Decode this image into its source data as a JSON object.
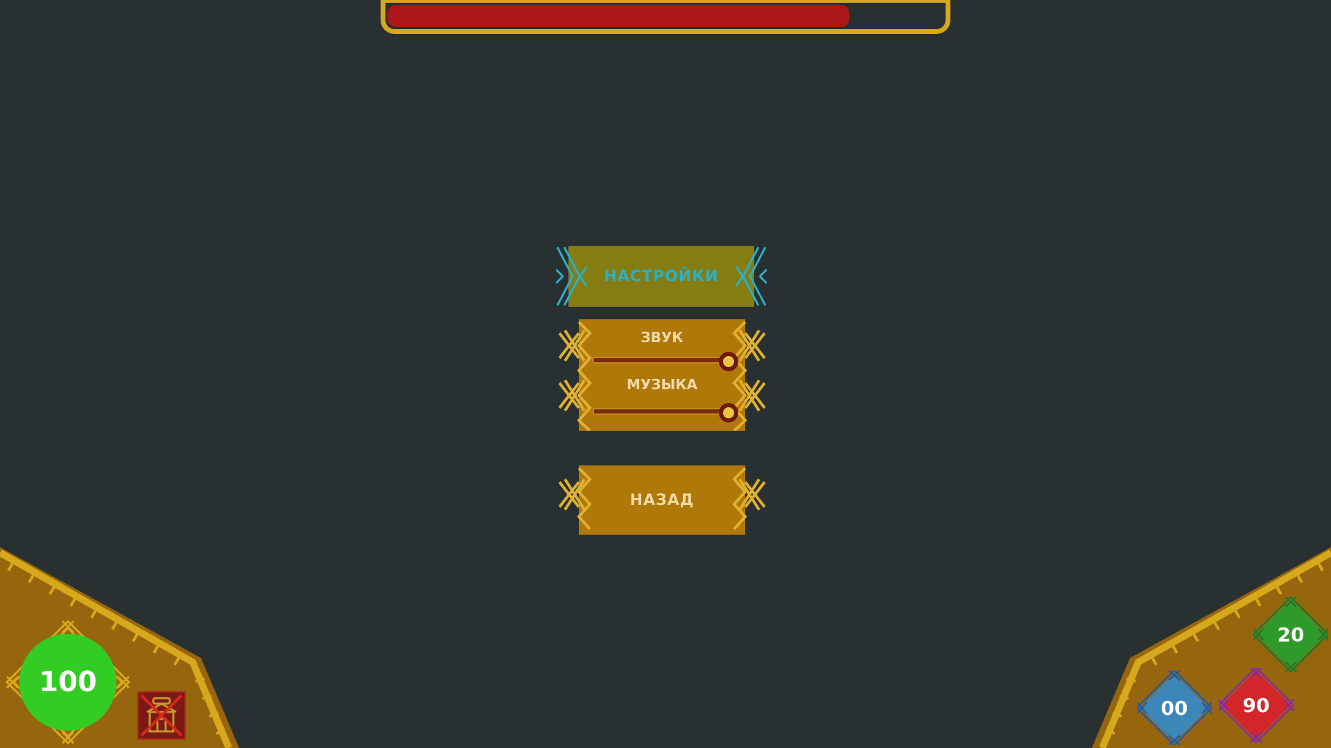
{
  "hud": {
    "top_bar_progress": 0.83,
    "top_bar_fill_color": "#ab1719",
    "health_value": "100",
    "health_color": "#33cc22",
    "item_slot_icon": "crossed-house-icon",
    "gems": [
      {
        "value": "20",
        "color": "#2e9a2a",
        "outline": "#1c7a2a"
      },
      {
        "value": "00",
        "color": "#3d86b8",
        "outline": "#2a5a9a"
      },
      {
        "value": "90",
        "color": "#d3262a",
        "outline": "#8a2aa0"
      }
    ]
  },
  "menu": {
    "title": "НАСТРОЙКИ",
    "sound_label": "ЗВУК",
    "sound_level": 1.0,
    "music_label": "МУЗЫКА",
    "music_level": 1.0,
    "back_label": "НАЗАД"
  },
  "colors": {
    "background": "#283032",
    "gold": "#d8a81c",
    "panel": "#b07808",
    "title_banner": "#857c12",
    "title_text": "#2bb0c8",
    "panel_text": "#efd9a8"
  }
}
